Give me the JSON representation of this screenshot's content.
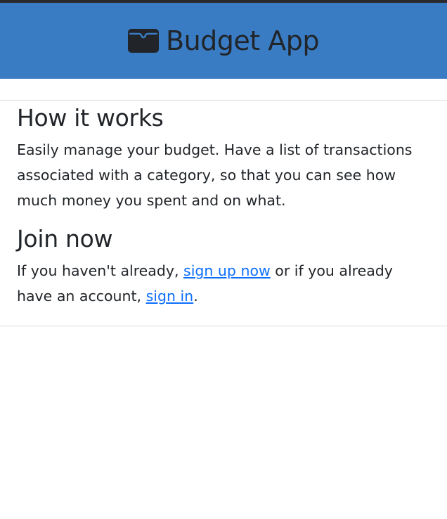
{
  "header": {
    "title": "Budget App",
    "icon": "wallet-icon",
    "background_color": "#3a7cc4"
  },
  "how_it_works": {
    "heading": "How it works",
    "text": "Easily manage your budget. Have a list of transactions associated with a category, so that you can see how much money you spent and on what."
  },
  "join_now": {
    "heading": "Join now",
    "text_before": "If you haven't already, ",
    "signup_link": "sign up now",
    "text_middle": " or if you already have an account, ",
    "signin_link": "sign in",
    "text_after": "."
  },
  "colors": {
    "link": "#0d6efd",
    "text": "#212529"
  }
}
